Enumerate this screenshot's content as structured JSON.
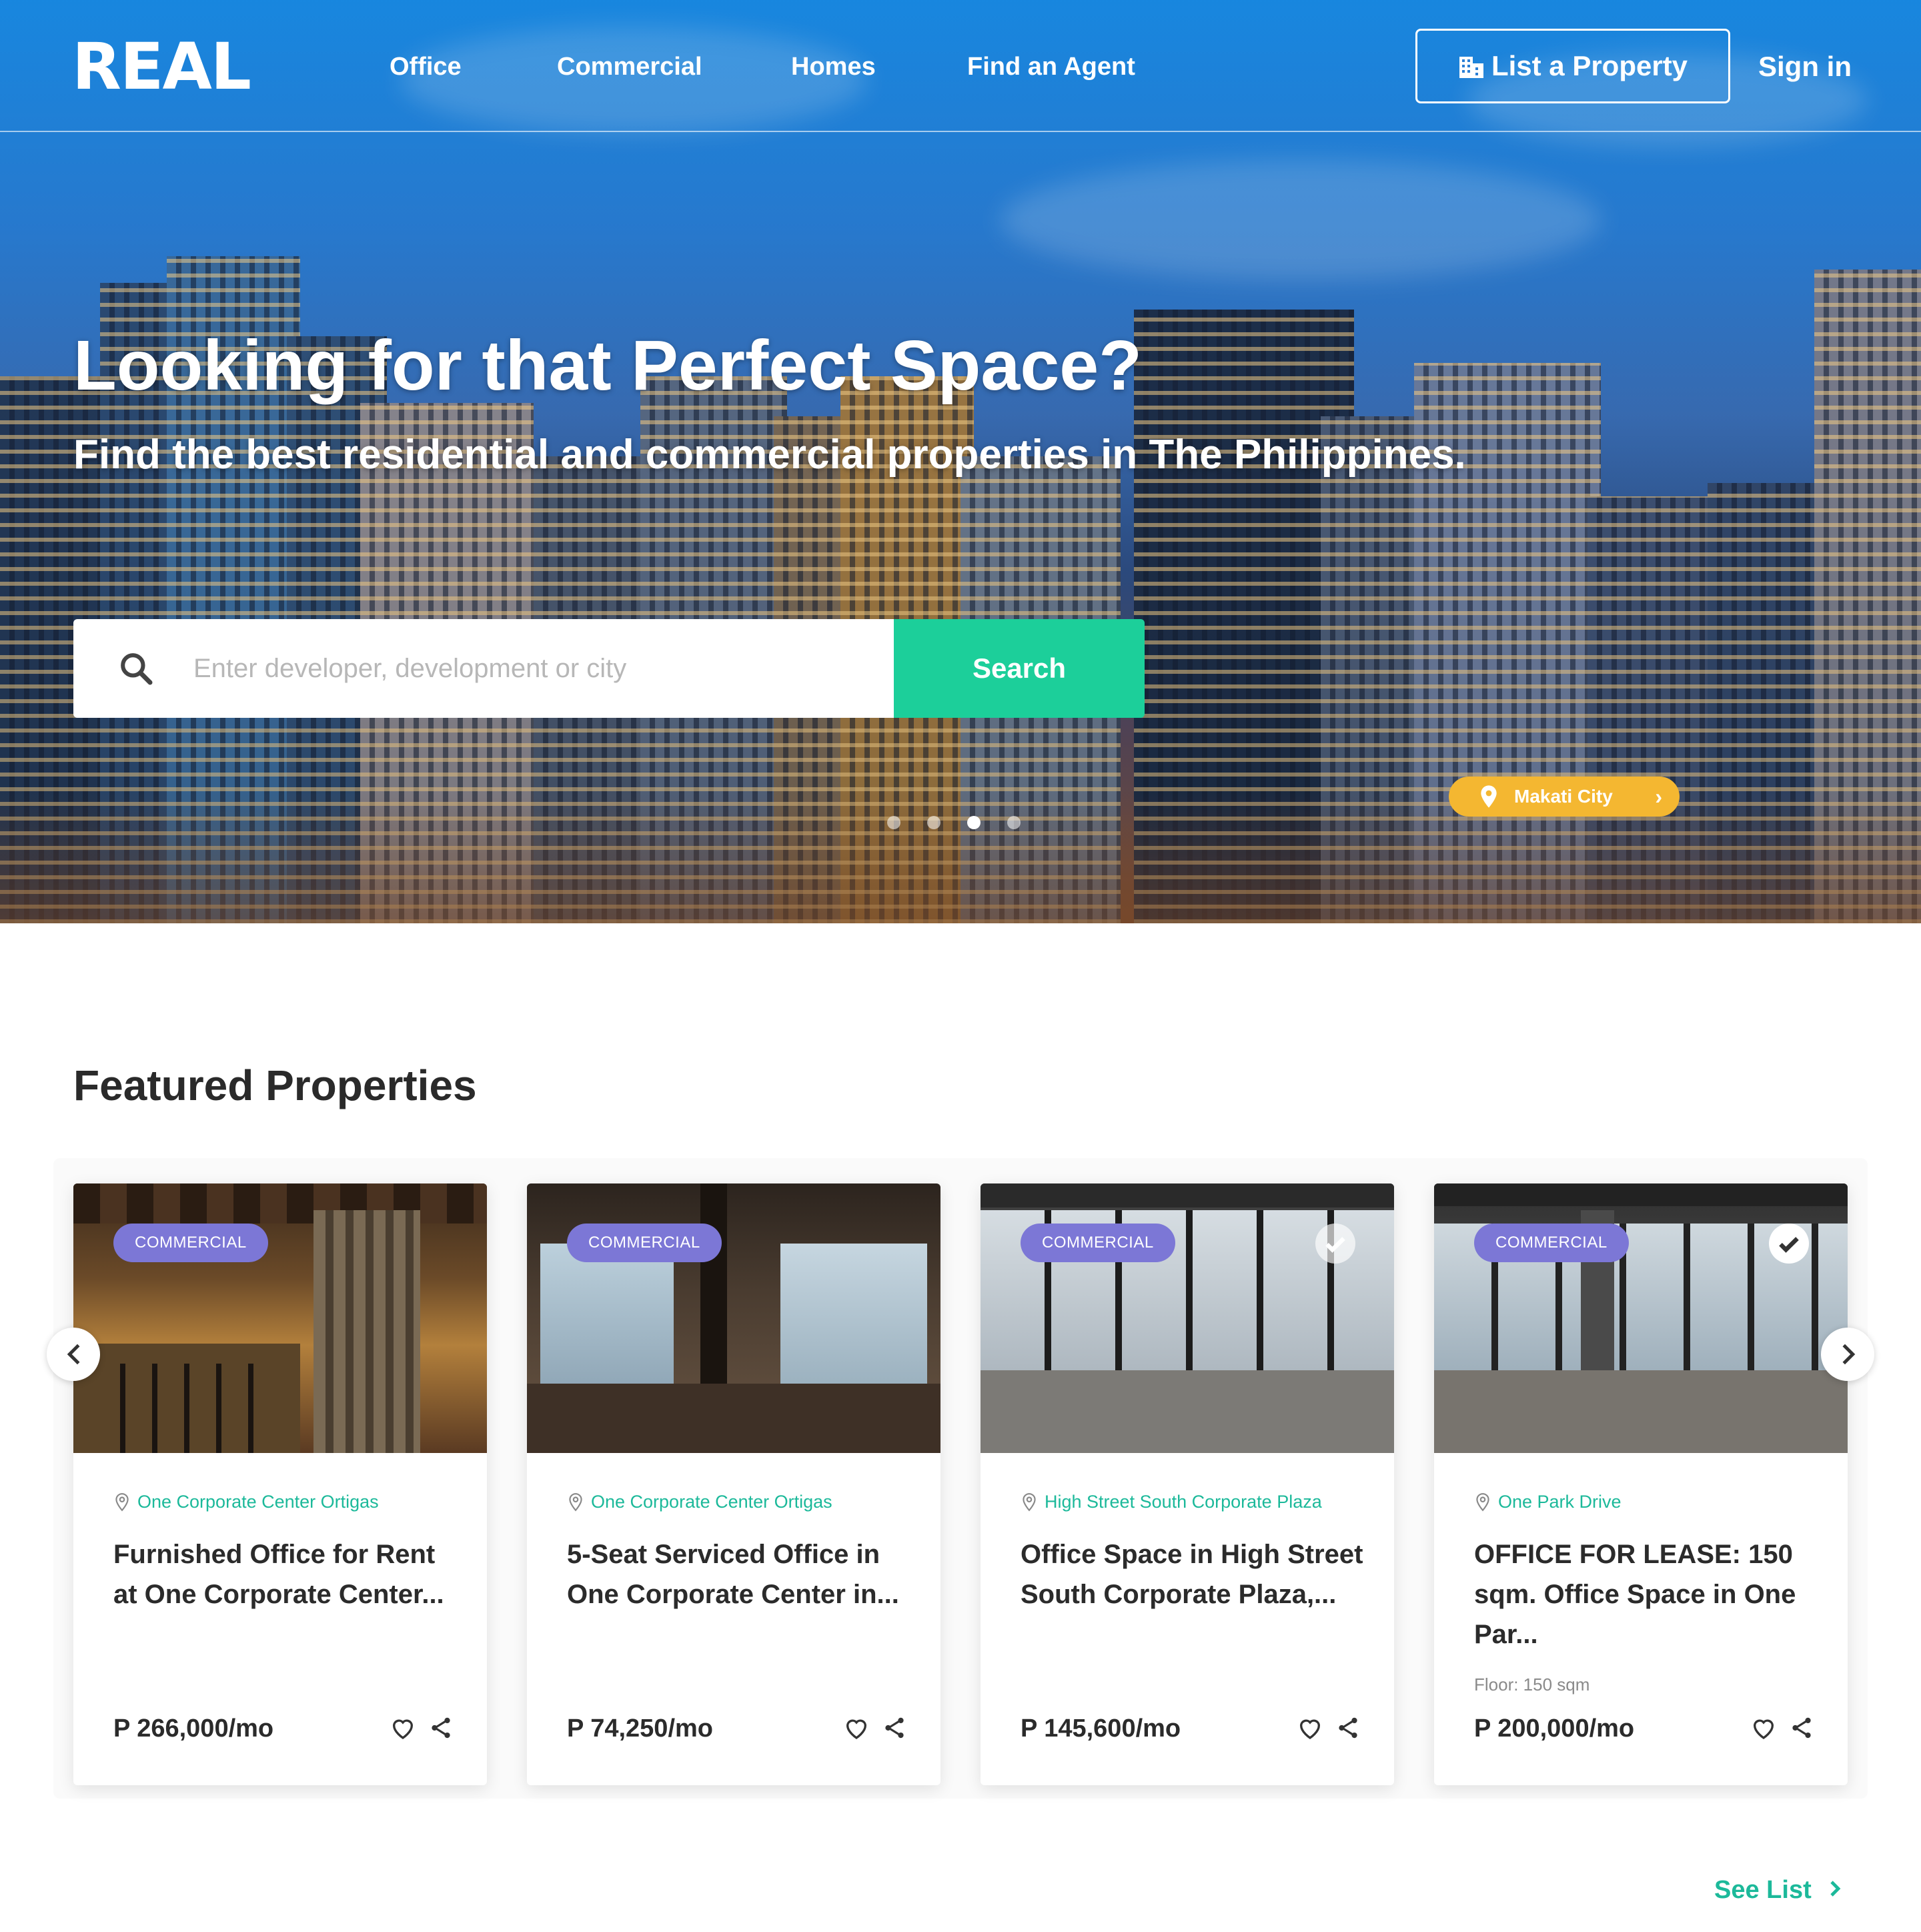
{
  "brand": {
    "logo_text": "REAL",
    "accent": "#1ccf9a",
    "tag_color": "#7c77d6",
    "pill_color": "#f4b731"
  },
  "nav": {
    "links": [
      "Office",
      "Commercial",
      "Homes",
      "Find an Agent"
    ],
    "list_property": "List a Property",
    "list_property_icon": "building-icon",
    "sign_in": "Sign in"
  },
  "hero": {
    "title": "Looking for that Perfect Space?",
    "subtitle": "Find the best residential and commercial properties in The Philippines.",
    "search": {
      "placeholder": "Enter developer, development or city",
      "button": "Search"
    },
    "location_pill": "Makati City",
    "slides": 4,
    "active_slide": 3
  },
  "featured": {
    "title": "Featured Properties",
    "see_list": "See List",
    "cards": [
      {
        "tag": "COMMERCIAL",
        "location": "One Corporate Center Ortigas",
        "title": "Furnished Office for Rent at One Corporate Center...",
        "floor": "",
        "price": "P 266,000/mo",
        "verified": false
      },
      {
        "tag": "COMMERCIAL",
        "location": "One Corporate Center Ortigas",
        "title": "5-Seat Serviced Office in One Corporate Center in...",
        "floor": "",
        "price": "P 74,250/mo",
        "verified": false
      },
      {
        "tag": "COMMERCIAL",
        "location": "High Street South Corporate Plaza",
        "title": "Office Space in High Street South Corporate Plaza,...",
        "floor": "",
        "price": "P 145,600/mo",
        "verified": true
      },
      {
        "tag": "COMMERCIAL",
        "location": "One Park Drive",
        "title": "OFFICE FOR LEASE: 150 sqm. Office Space in One Par...",
        "floor": "Floor: 150 sqm",
        "price": "P 200,000/mo",
        "verified": true
      }
    ]
  }
}
